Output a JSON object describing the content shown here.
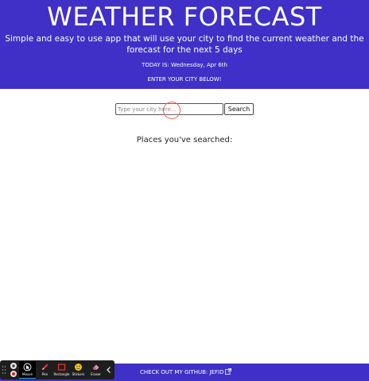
{
  "header": {
    "title": "WEATHER FORECAST",
    "subtitle": "Simple and easy to use app that will use your city to find the current weather and the forecast for the next 5 days",
    "date": "TODAY IS: Wednesday, Apr 6th",
    "instruction": "ENTER YOUR CITY BELOW!"
  },
  "search": {
    "placeholder": "Type your city here...",
    "value": "",
    "button_label": "Search"
  },
  "history": {
    "heading": "Places you've searched:",
    "items": []
  },
  "footer": {
    "link_label": "CHECK OUT MY GITHUB: JEFID",
    "icon": "external-link-icon"
  },
  "toolbar": {
    "tools": [
      {
        "label": "Mouse",
        "icon": "cursor-icon",
        "active": true
      },
      {
        "label": "Pen",
        "icon": "pen-icon"
      },
      {
        "label": "Rectangle",
        "icon": "rectangle-icon"
      },
      {
        "label": "Stickers",
        "icon": "smiley-icon"
      },
      {
        "label": "Eraser",
        "icon": "eraser-icon"
      }
    ]
  },
  "colors": {
    "brand": "#4030c8",
    "cursor_ring": "#e06060"
  }
}
